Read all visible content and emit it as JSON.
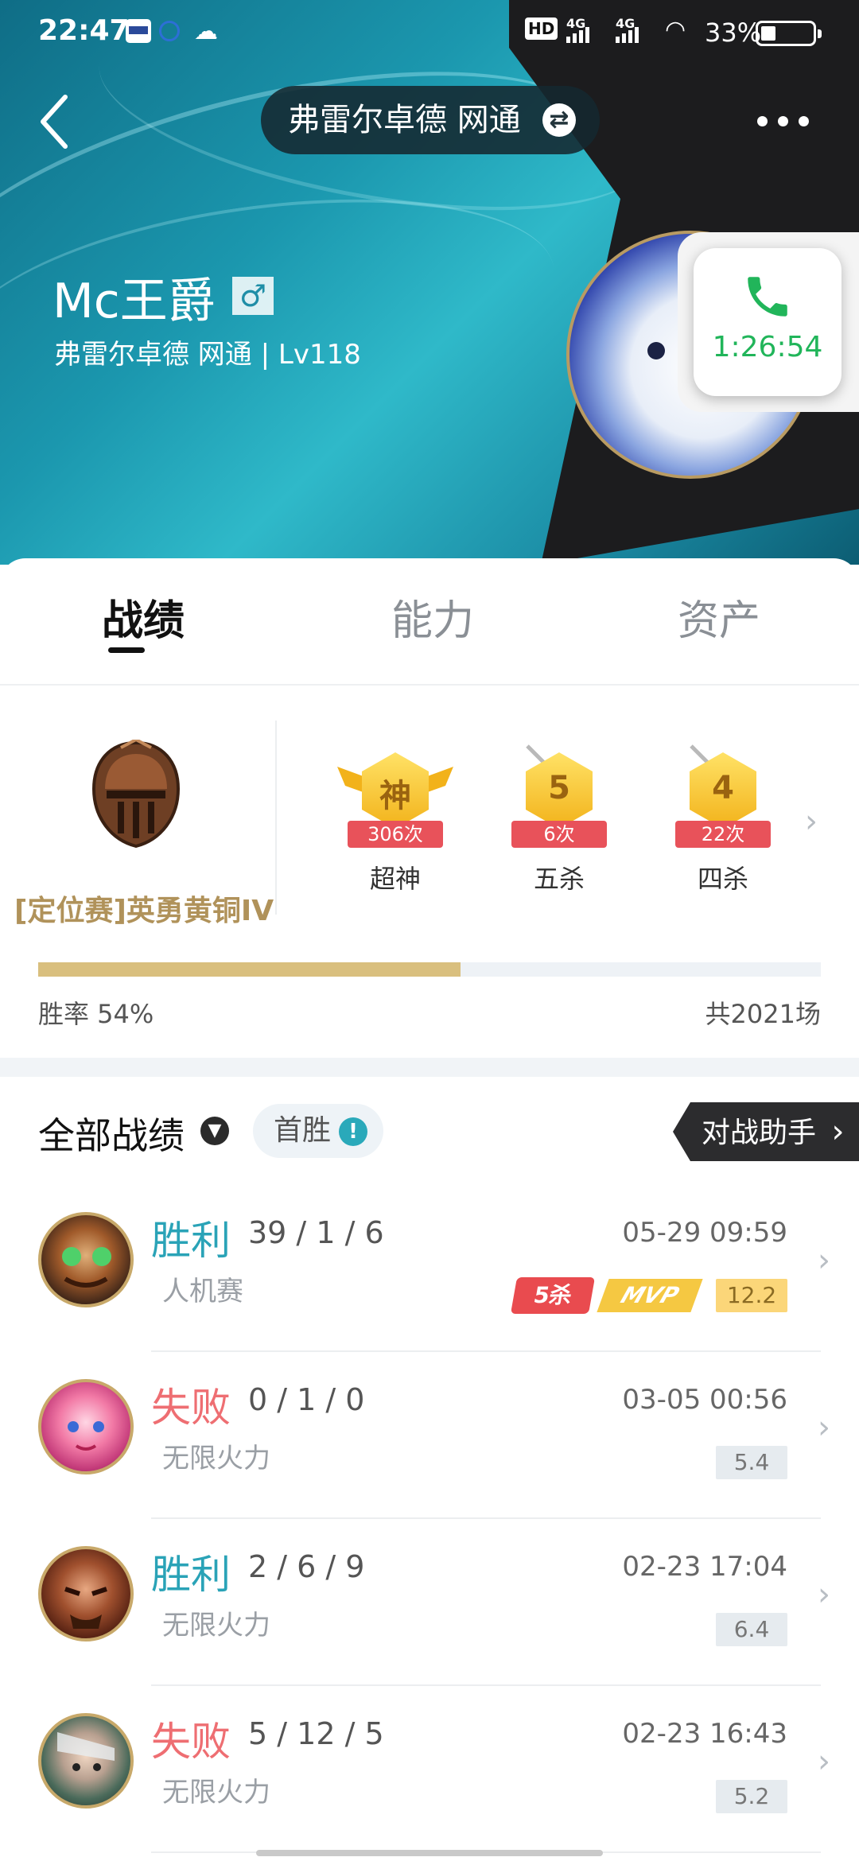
{
  "status_bar": {
    "time": "22:47",
    "hd_badge": "HD",
    "signal1": "4G",
    "signal2": "4G",
    "battery_pct": "33%"
  },
  "nav": {
    "server_switch": "弗雷尔卓德 网通"
  },
  "profile": {
    "name": "Mc王爵",
    "gender_icon": "♂",
    "subtitle": "弗雷尔卓德 网通 | Lv118"
  },
  "call": {
    "duration": "1:26:54"
  },
  "tabs": [
    {
      "label": "战绩",
      "active": true
    },
    {
      "label": "能力",
      "active": false
    },
    {
      "label": "资产",
      "active": false
    }
  ],
  "rank": {
    "label": "[定位赛]英勇黄铜IV"
  },
  "achievements": [
    {
      "glyph": "神",
      "count": "306次",
      "label": "超神"
    },
    {
      "glyph": "5",
      "count": "6次",
      "label": "五杀"
    },
    {
      "glyph": "4",
      "count": "22次",
      "label": "四杀"
    }
  ],
  "win_rate": {
    "label": "胜率  54%",
    "fraction": 0.54,
    "total": "共2021场"
  },
  "filters": {
    "all_records": "全部战绩",
    "first_win": "首胜",
    "battle_helper": "对战助手"
  },
  "matches": [
    {
      "result": "胜利",
      "outcome": "win",
      "kda": "39 / 1 / 6",
      "mode": "人机赛",
      "date": "05-29 09:59",
      "score": "12.2",
      "score_style": "gold",
      "kill_tag": "5杀",
      "mvp_tag": "MVP"
    },
    {
      "result": "失败",
      "outcome": "lose",
      "kda": "0 / 1 / 0",
      "mode": "无限火力",
      "date": "03-05 00:56",
      "score": "5.4",
      "score_style": "plain"
    },
    {
      "result": "胜利",
      "outcome": "win",
      "kda": "2 / 6 / 9",
      "mode": "无限火力",
      "date": "02-23 17:04",
      "score": "6.4",
      "score_style": "plain"
    },
    {
      "result": "失败",
      "outcome": "lose",
      "kda": "5 / 12 / 5",
      "mode": "无限火力",
      "date": "02-23 16:43",
      "score": "5.2",
      "score_style": "plain"
    }
  ],
  "colors": {
    "win": "#2aa3b7",
    "lose": "#ee6e72",
    "rank_gold": "#b0925a",
    "call_green": "#21b55a"
  }
}
